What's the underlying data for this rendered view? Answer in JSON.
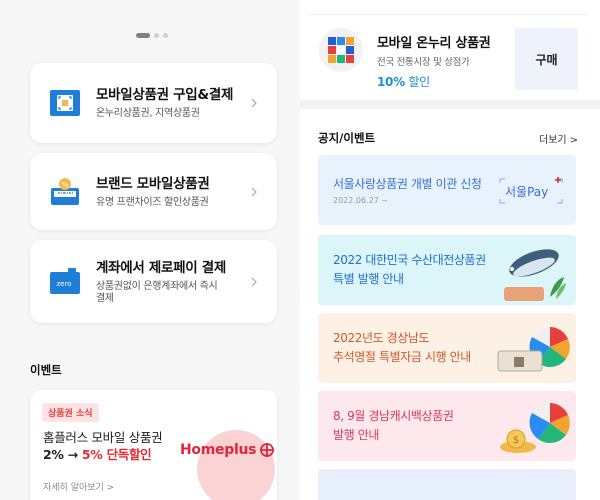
{
  "left": {
    "cards": [
      {
        "title": "모바일상품권 구입&결제",
        "subtitle": "온누리상품권, 지역상품권"
      },
      {
        "title": "브랜드 모바일상품권",
        "subtitle": "유명 프랜차이즈 할인상품권"
      },
      {
        "title": "계좌에서 제로페이 결제",
        "subtitle_line1": "상품권없이 은행계좌에서 즉시",
        "subtitle_line2": "결제",
        "icon_text": "zero"
      }
    ],
    "events_title": "이벤트",
    "event": {
      "badge": "상품권 소식",
      "line1": "홈플러스 모바일 상품권",
      "line2_prefix": "2% → ",
      "line2_highlight": "5% 단독할인",
      "logo": "Homeplus",
      "more": "자세히 알아보기 >"
    }
  },
  "right": {
    "buy": {
      "title": "모바일 온누리 상품권",
      "subtitle": "전국 전통시장 및 상점가",
      "pct": "10%",
      "pct_suffix": " 할인",
      "button": "구매"
    },
    "notice_title": "공지/이벤트",
    "notice_more": "더보기 >",
    "banners": [
      {
        "line1": "서울사랑상품권 개별 이관 신청",
        "date": "2022.06.27 ~",
        "logo": "서울Pay",
        "bg": "#e7f2fd",
        "color": "#3a6fd0"
      },
      {
        "line1": "2022 대한민국 수산대전상품권",
        "line2": "특별 발행 안내",
        "bg": "#dcf5f8",
        "color": "#1d6fd2"
      },
      {
        "line1": "2022년도 경상남도",
        "line2": "추석명절 특별자금 시행 안내",
        "bg": "#fdf0e4",
        "color": "#d05a2a"
      },
      {
        "line1": "8, 9월 경남캐시백상품권",
        "line2": "발행 안내",
        "bg": "#fde8ee",
        "color": "#d63a5e"
      },
      {
        "line1": "",
        "bg": "#e7eefc",
        "color": "#3a6fd0"
      }
    ]
  },
  "colors": {
    "accent_blue": "#1a8fd8",
    "accent_red": "#e02c35"
  }
}
